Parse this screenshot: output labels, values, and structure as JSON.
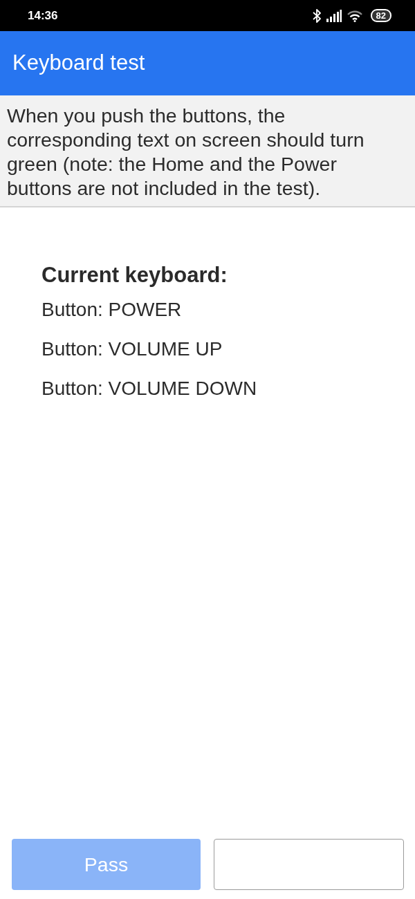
{
  "status_bar": {
    "time": "14:36",
    "battery": "82"
  },
  "app_bar": {
    "title": "Keyboard test"
  },
  "instructions": "When you push the buttons, the corresponding text on screen should turn green (note: the Home and the Power buttons are not included in the test).",
  "keyboard": {
    "heading": "Current keyboard:",
    "keys": [
      {
        "label": "Button: POWER",
        "pressed": false
      },
      {
        "label": "Button: VOLUME UP",
        "pressed": false
      },
      {
        "label": "Button: VOLUME DOWN",
        "pressed": false
      }
    ]
  },
  "buttons": [
    {
      "kind": "primary",
      "label": "Pass",
      "disabled": true
    },
    {
      "kind": "outline",
      "disabled": false
    }
  ]
}
